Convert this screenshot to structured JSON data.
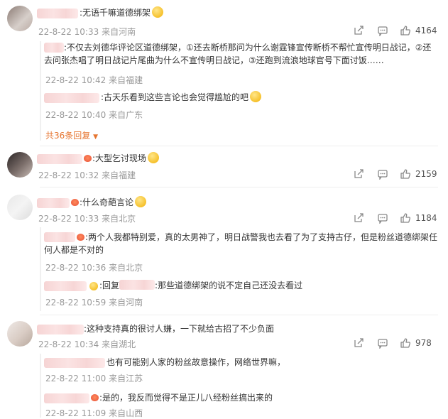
{
  "colors": {
    "accent_orange": "#e6742f",
    "meta_grey": "#999999",
    "name_blur": "#f6d4d4"
  },
  "comments": [
    {
      "text": ":无语千嘛道德绑架",
      "time": "22-8-22 10:33",
      "location": "来自河南",
      "likes": "4164",
      "replies": [
        {
          "text": ":不仅去刘德华评论区道德绑架，①还去断桥那问为什么谢霆锋宣传断桥不帮忙宣传明日战记，②还去问张杰唱了明日战记片尾曲为什么不宣传明日战记，③还跑到流浪地球官号下面讨饭……",
          "time": "22-8-22 10:42",
          "location": "来自福建"
        },
        {
          "text": ":古天乐看到这些言论也会觉得尴尬的吧",
          "time": "22-8-22 10:40",
          "location": "来自广东"
        }
      ],
      "more_replies": "共36条回复"
    },
    {
      "text": ":大型乞讨现场",
      "time": "22-8-22 10:32",
      "location": "来自福建",
      "likes": "2159"
    },
    {
      "text": ":什么奇葩言论",
      "time": "22-8-22 10:33",
      "location": "来自北京",
      "likes": "1184",
      "replies": [
        {
          "text": ":两个人我都特别爱，真的太男神了，明日战警我也去看了为了支持古仔，但是粉丝道德绑架任何人都是不对的",
          "time": "22-8-22 10:36",
          "location": "来自北京"
        },
        {
          "reply_prefix": ":回复",
          "text": ":那些道德绑架的说不定自己还没去看过",
          "time": "22-8-22 10:59",
          "location": "来自河南"
        }
      ]
    },
    {
      "text": ":这种支持真的很讨人嫌，一下就给古招了不少负面",
      "time": "22-8-22 10:34",
      "location": "来自湖北",
      "likes": "978",
      "replies": [
        {
          "text": "也有可能别人家的粉丝故意操作，网络世界嘛，",
          "time": "22-8-22 11:00",
          "location": "来自江苏"
        },
        {
          "text": ":是的，我反而觉得不是正儿八经粉丝搞出来的",
          "time": "22-8-22 11:09",
          "location": "来自山西"
        }
      ]
    }
  ]
}
